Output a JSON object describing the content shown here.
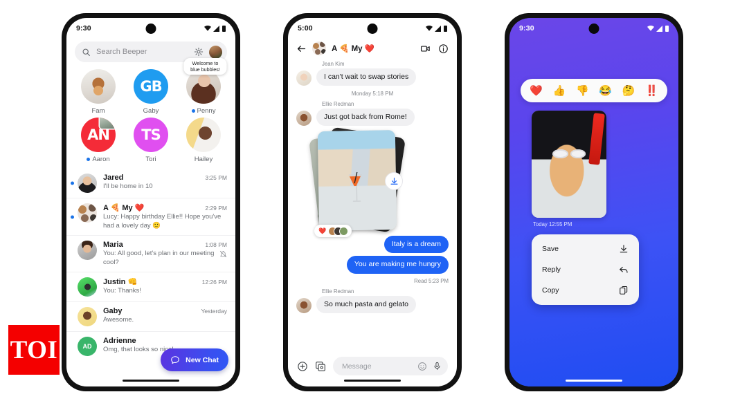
{
  "watermark": {
    "label": "TOI"
  },
  "phone1": {
    "status": {
      "time": "9:30",
      "wifi_icon": "wifi-icon",
      "signal_icon": "signal-icon",
      "battery_icon": "battery-icon"
    },
    "search": {
      "placeholder": "Search Beeper",
      "search_icon": "search-icon",
      "settings_icon": "gear-icon",
      "avatar_icon": "profile-avatar"
    },
    "pinned": [
      {
        "name": "Fam",
        "kind": "photo",
        "online": false
      },
      {
        "name": "Gaby",
        "kind": "initials",
        "initials": "GB",
        "color": "#1f9cf0",
        "online": false
      },
      {
        "name": "Penny",
        "kind": "photo",
        "online": true,
        "tooltip": "Welcome to blue bubbles!"
      },
      {
        "name": "Aaron",
        "kind": "initials",
        "initials": "AN",
        "color": "#f42b38",
        "online": true,
        "badge": true
      },
      {
        "name": "Tori",
        "kind": "initials",
        "initials": "TS",
        "color": "#e04ff0",
        "online": false
      },
      {
        "name": "Hailey",
        "kind": "photo",
        "online": false
      }
    ],
    "chats": [
      {
        "name": "Jared",
        "time": "3:25 PM",
        "preview": "I'll be home in 10",
        "unread": true,
        "muted": false
      },
      {
        "name": "A 🍕 My ❤️",
        "time": "2:29 PM",
        "preview": "Lucy: Happy birthday Ellie!! Hope you've had a lovely day  🙂",
        "unread": true,
        "muted": false
      },
      {
        "name": "Maria",
        "time": "1:08 PM",
        "preview": "You: All good, let's plan in our meeting cool?",
        "unread": false,
        "muted": true
      },
      {
        "name": "Justin 👊",
        "time": "12:26 PM",
        "preview": "You: Thanks!",
        "unread": false,
        "muted": false
      },
      {
        "name": "Gaby",
        "time": "Yesterday",
        "preview": "Awesome.",
        "unread": false,
        "muted": false
      },
      {
        "name": "Adrienne",
        "time": "",
        "preview": "Omg, that looks so nice!",
        "unread": false,
        "muted": false,
        "initials": "AD"
      }
    ],
    "fab": {
      "label": "New Chat",
      "icon": "chat-bubble-icon"
    }
  },
  "phone2": {
    "status": {
      "time": "5:00"
    },
    "header": {
      "title": "A 🍕 My ❤️",
      "back_icon": "back-arrow-icon",
      "video_icon": "video-call-icon",
      "info_icon": "info-icon",
      "group_avatar": "group-avatar"
    },
    "messages": [
      {
        "type": "incoming",
        "sender": "Jean Kim",
        "text": "I can't wait to swap stories"
      },
      {
        "type": "daystamp",
        "text": "Monday 5:18 PM"
      },
      {
        "type": "incoming",
        "sender": "Ellie Redman",
        "text": "Just got back from Rome!"
      },
      {
        "type": "photo-stack",
        "reaction": "❤️",
        "download_icon": "download-icon"
      },
      {
        "type": "outgoing",
        "text": "Italy is a dream"
      },
      {
        "type": "outgoing",
        "text": "You are making me hungry",
        "receipt": "Read  5:23 PM"
      },
      {
        "type": "incoming",
        "sender": "Ellie Redman",
        "text": "So much pasta and gelato"
      }
    ],
    "composer": {
      "placeholder": "Message",
      "plus_icon": "plus-icon",
      "gallery_icon": "gallery-camera-icon",
      "emoji_icon": "emoji-icon",
      "mic_icon": "microphone-icon"
    }
  },
  "phone3": {
    "status": {
      "time": "9:30"
    },
    "reactions": [
      "❤️",
      "👍",
      "👎",
      "😂",
      "🤔",
      "‼️"
    ],
    "photo": {
      "stamp": "Today  12:55 PM",
      "alt": "dog-photo"
    },
    "menu": [
      {
        "label": "Save",
        "icon": "download-icon"
      },
      {
        "label": "Reply",
        "icon": "reply-arrow-icon"
      },
      {
        "label": "Copy",
        "icon": "copy-icon"
      }
    ],
    "colors": {
      "gradient_top": "#6b46e8",
      "gradient_bottom": "#1f4df2"
    }
  }
}
